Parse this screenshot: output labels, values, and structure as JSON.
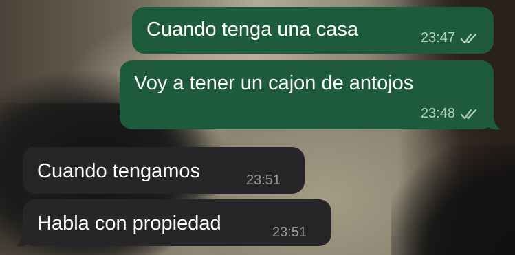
{
  "colors": {
    "outgoing_bubble": "#1e5b3c",
    "incoming_bubble": "#262628",
    "text": "#ffffff",
    "outgoing_meta": "#b9cfc3",
    "incoming_meta": "#9a9a9e"
  },
  "messages": [
    {
      "direction": "outgoing",
      "text": "Cuando tenga una casa",
      "time": "23:47",
      "status_icon": "double-check-icon"
    },
    {
      "direction": "outgoing",
      "text": "Voy a tener un cajon de antojos",
      "time": "23:48",
      "status_icon": "double-check-icon"
    },
    {
      "direction": "incoming",
      "text": "Cuando tengamos",
      "time": "23:51"
    },
    {
      "direction": "incoming",
      "text": "Habla con propiedad",
      "time": "23:51"
    }
  ]
}
